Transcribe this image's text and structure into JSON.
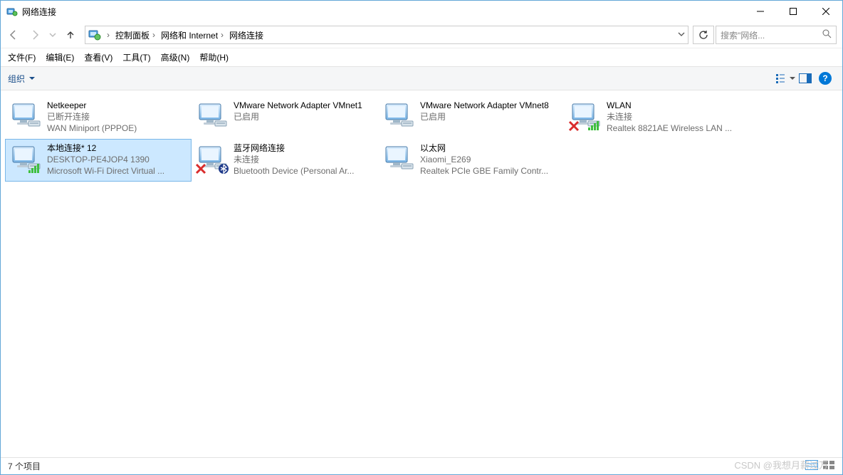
{
  "window": {
    "title": "网络连接"
  },
  "breadcrumb": {
    "items": [
      "控制面板",
      "网络和 Internet",
      "网络连接"
    ]
  },
  "search": {
    "placeholder": "搜索\"网络..."
  },
  "menu": {
    "file": "文件(F)",
    "edit": "编辑(E)",
    "view": "查看(V)",
    "tools": "工具(T)",
    "advanced": "高级(N)",
    "help": "帮助(H)"
  },
  "toolbar": {
    "organize": "组织"
  },
  "items": [
    {
      "name": "Netkeeper",
      "line2": "已断开连接",
      "line3": "WAN Miniport (PPPOE)",
      "selected": false,
      "disabled": false,
      "status_x": false,
      "bt": false
    },
    {
      "name": "VMware Network Adapter VMnet1",
      "line2": "已启用",
      "line3": "",
      "selected": false,
      "disabled": false,
      "status_x": false,
      "bt": false
    },
    {
      "name": "VMware Network Adapter VMnet8",
      "line2": "已启用",
      "line3": "",
      "selected": false,
      "disabled": false,
      "status_x": false,
      "bt": false
    },
    {
      "name": "WLAN",
      "line2": "未连接",
      "line3": "Realtek 8821AE Wireless LAN ...",
      "selected": false,
      "disabled": false,
      "status_x": true,
      "bt": false
    },
    {
      "name": "本地连接* 12",
      "line2": "DESKTOP-PE4JOP4 1390",
      "line3": "Microsoft Wi-Fi Direct Virtual ...",
      "selected": true,
      "disabled": false,
      "status_x": false,
      "bt": false
    },
    {
      "name": "蓝牙网络连接",
      "line2": "未连接",
      "line3": "Bluetooth Device (Personal Ar...",
      "selected": false,
      "disabled": false,
      "status_x": true,
      "bt": true
    },
    {
      "name": "以太网",
      "line2": "Xiaomi_E269",
      "line3": "Realtek PCIe GBE Family Contr...",
      "selected": false,
      "disabled": false,
      "status_x": false,
      "bt": false
    }
  ],
  "status": {
    "text": "7 个项目"
  },
  "watermark": "CSDN @我想月薪过万"
}
